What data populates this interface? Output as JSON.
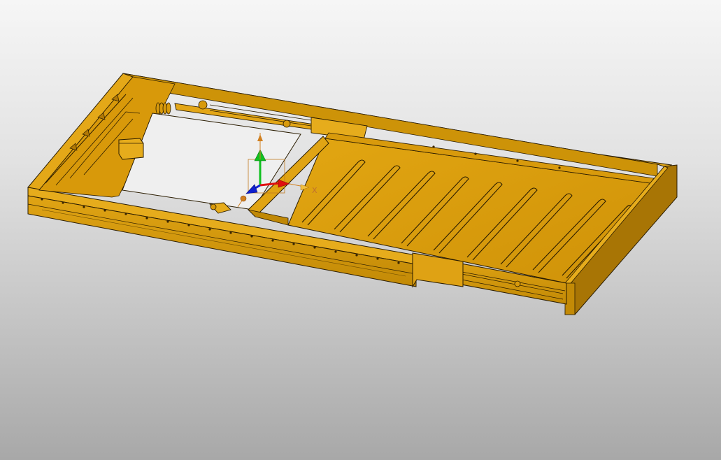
{
  "viewport": {
    "background_top": "#f6f6f6",
    "background_bottom": "#a8a8a8"
  },
  "model": {
    "color_face": "#d99c0a",
    "color_face_light": "#e6ac1c",
    "color_face_dark": "#a87505",
    "color_edge": "#2a1c00",
    "rib_count": 9,
    "rail_holes": 22
  },
  "triad": {
    "x_label": "X",
    "x_color": "#e01010",
    "y_color": "#10c020",
    "z_color": "#1020d0",
    "origin_color": "#d08020",
    "icons": [
      "triad-x-arrow-icon",
      "triad-y-arrow-icon",
      "triad-z-arrow-icon",
      "triad-origin-icon"
    ]
  }
}
